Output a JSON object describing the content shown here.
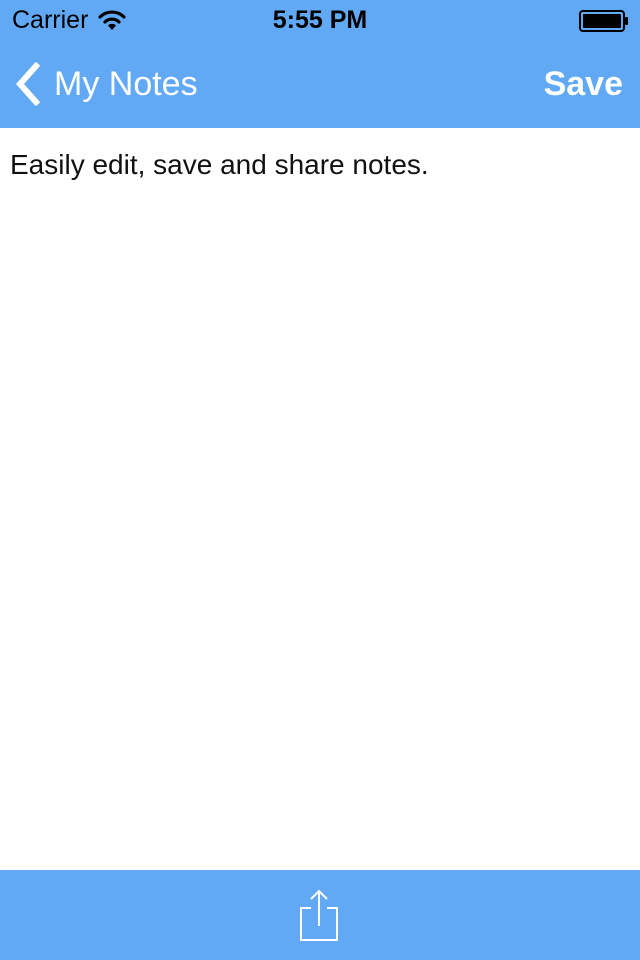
{
  "status_bar": {
    "carrier": "Carrier",
    "time": "5:55 PM",
    "wifi_icon": "wifi-icon",
    "battery_icon": "battery-icon"
  },
  "nav_bar": {
    "back_label": "My Notes",
    "back_icon": "chevron-left-icon",
    "save_label": "Save"
  },
  "note": {
    "text": "Easily edit, save and share notes."
  },
  "toolbar": {
    "share_icon": "share-icon"
  },
  "colors": {
    "bar_background": "#61a9f5",
    "bar_foreground": "#ffffff",
    "status_foreground": "#000000",
    "page_background": "#ffffff",
    "note_text": "#111111"
  }
}
